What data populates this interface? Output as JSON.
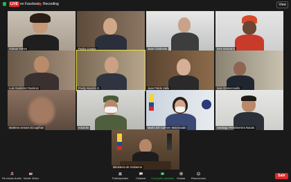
{
  "topbar": {
    "live": "LIVE",
    "facebook": "en Facebook",
    "recording": "Recording",
    "view": "View"
  },
  "participants": [
    "Xiomar Torres",
    "Pedro Crespo",
    "Juan Cárdenas",
    "ines manzano",
    "Luis Gutiérrez Ramírez",
    "Fredy Alarcón G.",
    "Juan Pablo Vallo",
    "Ivan Gomezcoello",
    "Marlene xenxes Ezcupiñan",
    "eduardo",
    "María del Carmen Maldonado",
    "Santiago Peñaherrera Navas",
    "Ministerio de Gobierno"
  ],
  "toolbar": {
    "unmute": "Re-iniciar Audio",
    "video": "Iniciar Video",
    "participants": "Participantes",
    "participants_count": "13",
    "chat": "Chatear",
    "share": "Compartir pantalla",
    "record": "Grabar",
    "reactions": "Reacciones",
    "leave": "Salir"
  },
  "colors": {
    "active_speaker": "#e8e33a",
    "live_red": "#e02828",
    "share_green": "#2bb24c"
  }
}
